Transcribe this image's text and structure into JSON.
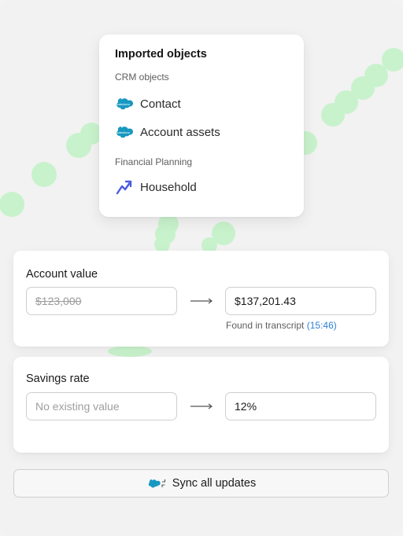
{
  "import_card": {
    "title": "Imported objects",
    "groups": [
      {
        "label": "CRM objects",
        "items": [
          {
            "label": "Contact",
            "icon": "salesforce-cloud-icon"
          },
          {
            "label": "Account assets",
            "icon": "salesforce-cloud-icon"
          }
        ]
      },
      {
        "label": "Financial Planning",
        "items": [
          {
            "label": "Household",
            "icon": "trend-arrow-icon"
          }
        ]
      }
    ],
    "salesforce_icon_text": "salesforce"
  },
  "fields": [
    {
      "title": "Account value",
      "old_value": "$123,000",
      "new_value": "$137,201.43",
      "source_prefix": "Found in transcript ",
      "source_timestamp": "(15:46)"
    },
    {
      "title": "Savings rate",
      "old_placeholder": "No existing value",
      "new_value": "12%"
    }
  ],
  "sync_button": {
    "label": "Sync all updates",
    "icon": "salesforce-sync-icon"
  },
  "colors": {
    "accent_blue": "#2e7fd6",
    "salesforce_blue": "#1798c1",
    "decor_green": "#c8f2cc",
    "trend_icon_blue": "#4a5ce0"
  }
}
